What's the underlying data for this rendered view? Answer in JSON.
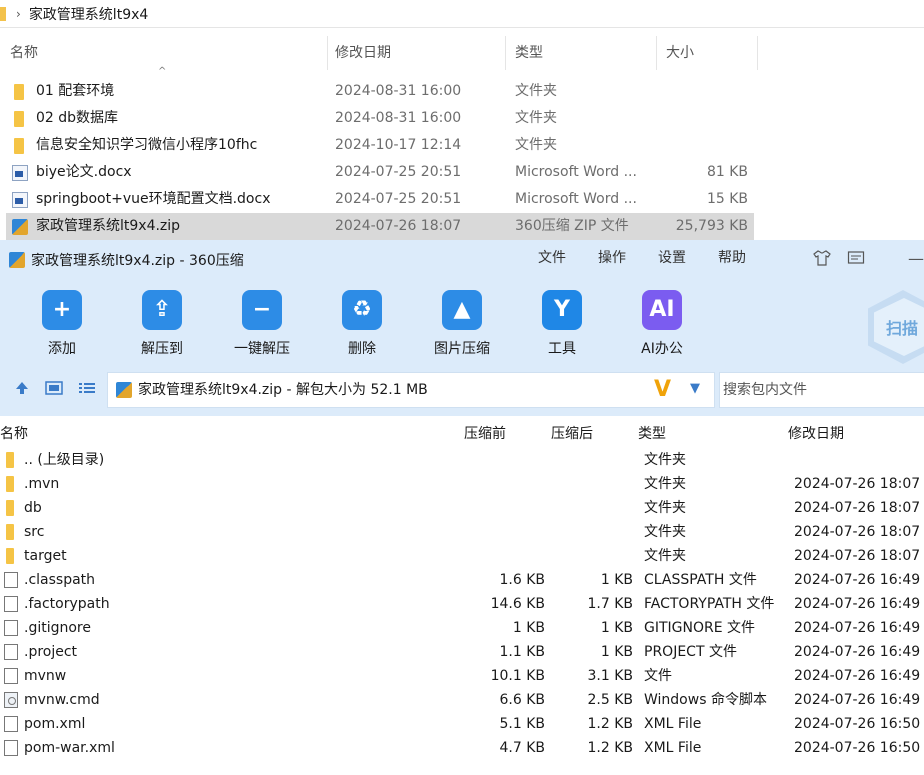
{
  "explorer": {
    "path": "家政管理系统lt9x4",
    "columns": {
      "name": "名称",
      "modified": "修改日期",
      "type": "类型",
      "size": "大小"
    },
    "rows": [
      {
        "name": "01 配套环境",
        "date": "2024-08-31 16:00",
        "type": "文件夹",
        "size": "",
        "icon": "folder-icon"
      },
      {
        "name": "02 db数据库",
        "date": "2024-08-31 16:00",
        "type": "文件夹",
        "size": "",
        "icon": "folder-icon"
      },
      {
        "name": "信息安全知识学习微信小程序10fhc",
        "date": "2024-10-17 12:14",
        "type": "文件夹",
        "size": "",
        "icon": "folder-icon"
      },
      {
        "name": "biye论文.docx",
        "date": "2024-07-25 20:51",
        "type": "Microsoft Word ...",
        "size": "81 KB",
        "icon": "word-doc-icon"
      },
      {
        "name": "springboot+vue环境配置文档.docx",
        "date": "2024-07-25 20:51",
        "type": "Microsoft Word ...",
        "size": "15 KB",
        "icon": "word-doc-icon"
      },
      {
        "name": "家政管理系统lt9x4.zip",
        "date": "2024-07-26 18:07",
        "type": "360压缩 ZIP 文件",
        "size": "25,793 KB",
        "icon": "zip-archive-icon"
      }
    ]
  },
  "zip": {
    "title": "家政管理系统lt9x4.zip - 360压缩",
    "menu": [
      "文件",
      "操作",
      "设置",
      "帮助"
    ],
    "tools": [
      {
        "label": "添加",
        "icon": "add-folder-icon",
        "color": "#2d8ce6"
      },
      {
        "label": "解压到",
        "icon": "extract-to-icon",
        "color": "#2d8ce6"
      },
      {
        "label": "一键解压",
        "icon": "one-click-extract-icon",
        "color": "#2d8ce6"
      },
      {
        "label": "删除",
        "icon": "recycle-bin-icon",
        "color": "#2d8ce6"
      },
      {
        "label": "图片压缩",
        "icon": "image-compress-icon",
        "color": "#2d8ce6"
      },
      {
        "label": "工具",
        "icon": "tools-icon",
        "color": "#1f87e6"
      },
      {
        "label": "AI办公",
        "icon": "ai-office-icon",
        "color": "#7b5cf0"
      }
    ],
    "scan_label": "扫描",
    "path_text": "家政管理系统lt9x4.zip - 解包大小为 52.1 MB",
    "search_placeholder": "搜索包内文件",
    "columns": {
      "name": "名称",
      "before": "压缩前",
      "after": "压缩后",
      "type": "类型",
      "date": "修改日期"
    },
    "rows": [
      {
        "name": ".. (上级目录)",
        "before": "",
        "after": "",
        "type": "文件夹",
        "date": "",
        "icon": "folder"
      },
      {
        "name": ".mvn",
        "before": "",
        "after": "",
        "type": "文件夹",
        "date": "2024-07-26 18:07",
        "icon": "folder"
      },
      {
        "name": "db",
        "before": "",
        "after": "",
        "type": "文件夹",
        "date": "2024-07-26 18:07",
        "icon": "folder"
      },
      {
        "name": "src",
        "before": "",
        "after": "",
        "type": "文件夹",
        "date": "2024-07-26 18:07",
        "icon": "folder"
      },
      {
        "name": "target",
        "before": "",
        "after": "",
        "type": "文件夹",
        "date": "2024-07-26 18:07",
        "icon": "folder"
      },
      {
        "name": ".classpath",
        "before": "1.6 KB",
        "after": "1 KB",
        "type": "CLASSPATH 文件",
        "date": "2024-07-26 16:49",
        "icon": "file"
      },
      {
        "name": ".factorypath",
        "before": "14.6 KB",
        "after": "1.7 KB",
        "type": "FACTORYPATH 文件",
        "date": "2024-07-26 16:49",
        "icon": "file"
      },
      {
        "name": ".gitignore",
        "before": "1 KB",
        "after": "1 KB",
        "type": "GITIGNORE 文件",
        "date": "2024-07-26 16:49",
        "icon": "file"
      },
      {
        "name": ".project",
        "before": "1.1 KB",
        "after": "1 KB",
        "type": "PROJECT 文件",
        "date": "2024-07-26 16:49",
        "icon": "file"
      },
      {
        "name": "mvnw",
        "before": "10.1 KB",
        "after": "3.1 KB",
        "type": "文件",
        "date": "2024-07-26 16:49",
        "icon": "file"
      },
      {
        "name": "mvnw.cmd",
        "before": "6.6 KB",
        "after": "2.5 KB",
        "type": "Windows 命令脚本",
        "date": "2024-07-26 16:49",
        "icon": "cmd"
      },
      {
        "name": "pom.xml",
        "before": "5.1 KB",
        "after": "1.2 KB",
        "type": "XML File",
        "date": "2024-07-26 16:50",
        "icon": "file"
      },
      {
        "name": "pom-war.xml",
        "before": "4.7 KB",
        "after": "1.2 KB",
        "type": "XML File",
        "date": "2024-07-26 16:50",
        "icon": "file"
      }
    ]
  }
}
